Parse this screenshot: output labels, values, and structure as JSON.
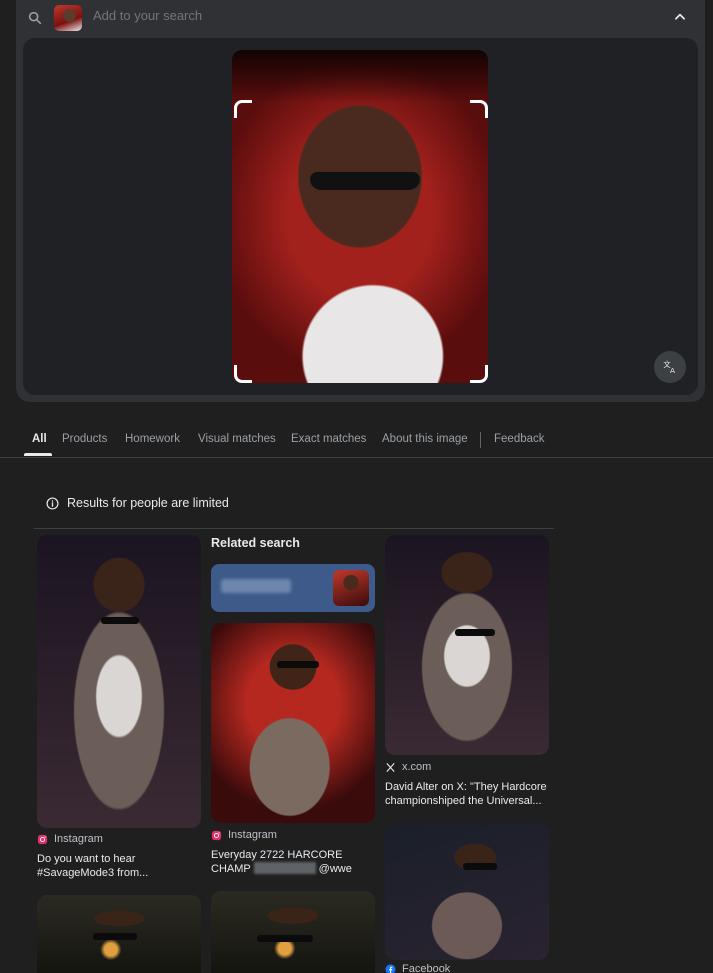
{
  "search": {
    "placeholder": "Add to your search"
  },
  "tabs": [
    {
      "label": "All",
      "active": true
    },
    {
      "label": "Products"
    },
    {
      "label": "Homework"
    },
    {
      "label": "Visual matches"
    },
    {
      "label": "Exact matches"
    },
    {
      "label": "About this image"
    },
    {
      "label": "Feedback"
    }
  ],
  "notice": "Results for people are limited",
  "related": {
    "heading": "Related search"
  },
  "results": [
    {
      "source": "Instagram",
      "source_icon": "instagram-icon",
      "title": "Do you want to hear #SavageMode3 from..."
    },
    {
      "source": "Instagram",
      "source_icon": "instagram-icon",
      "title_part1": "Everyday 2722 HARCORE CHAMP",
      "title_part2": "@wwe"
    },
    {
      "source": "x.com",
      "source_icon": "x-icon",
      "title": "David Alter on X: \"They Hardcore championshiped the Universal..."
    },
    {
      "source": "Facebook",
      "source_icon": "facebook-icon"
    }
  ],
  "colors": {
    "page_bg": "#1f1f1f",
    "panel_bg": "#303134",
    "related_chip": "#3d5a8a",
    "instagram": "#e1306c",
    "facebook": "#1877f2"
  }
}
